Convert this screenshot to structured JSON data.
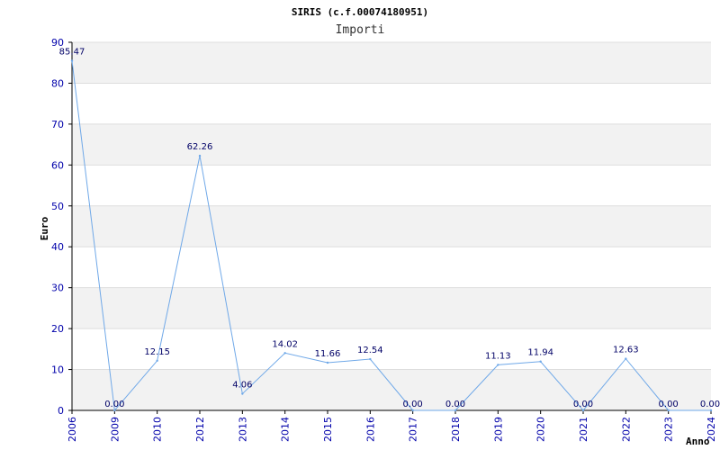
{
  "chart_data": {
    "type": "line",
    "title": "SIRIS (c.f.00074180951)",
    "subtitle": "Importi",
    "xlabel": "Anno",
    "ylabel": "Euro",
    "ylim": [
      0,
      90
    ],
    "yticks": [
      0,
      10,
      20,
      30,
      40,
      50,
      60,
      70,
      80,
      90
    ],
    "categories": [
      "2006",
      "2009",
      "2010",
      "2012",
      "2013",
      "2014",
      "2015",
      "2016",
      "2017",
      "2018",
      "2019",
      "2020",
      "2021",
      "2022",
      "2023",
      "2024"
    ],
    "values": [
      85.47,
      0.0,
      12.15,
      62.26,
      4.06,
      14.02,
      11.66,
      12.54,
      0.0,
      0.0,
      11.13,
      11.94,
      0.0,
      12.63,
      0.0,
      0.0
    ],
    "value_labels": [
      "85.47",
      "0.00",
      "12.15",
      "62.26",
      "4.06",
      "14.02",
      "11.66",
      "12.54",
      "0.00",
      "0.00",
      "11.13",
      "11.94",
      "0.00",
      "12.63",
      "0.00",
      "0.00"
    ],
    "grid": true,
    "legend": "none",
    "colors": {
      "line": "#6fa8e8",
      "band": "#f2f2f2",
      "grid": "#dddddd",
      "axis": "#000000",
      "ticks": "#0000aa",
      "labels": "#000066"
    }
  }
}
